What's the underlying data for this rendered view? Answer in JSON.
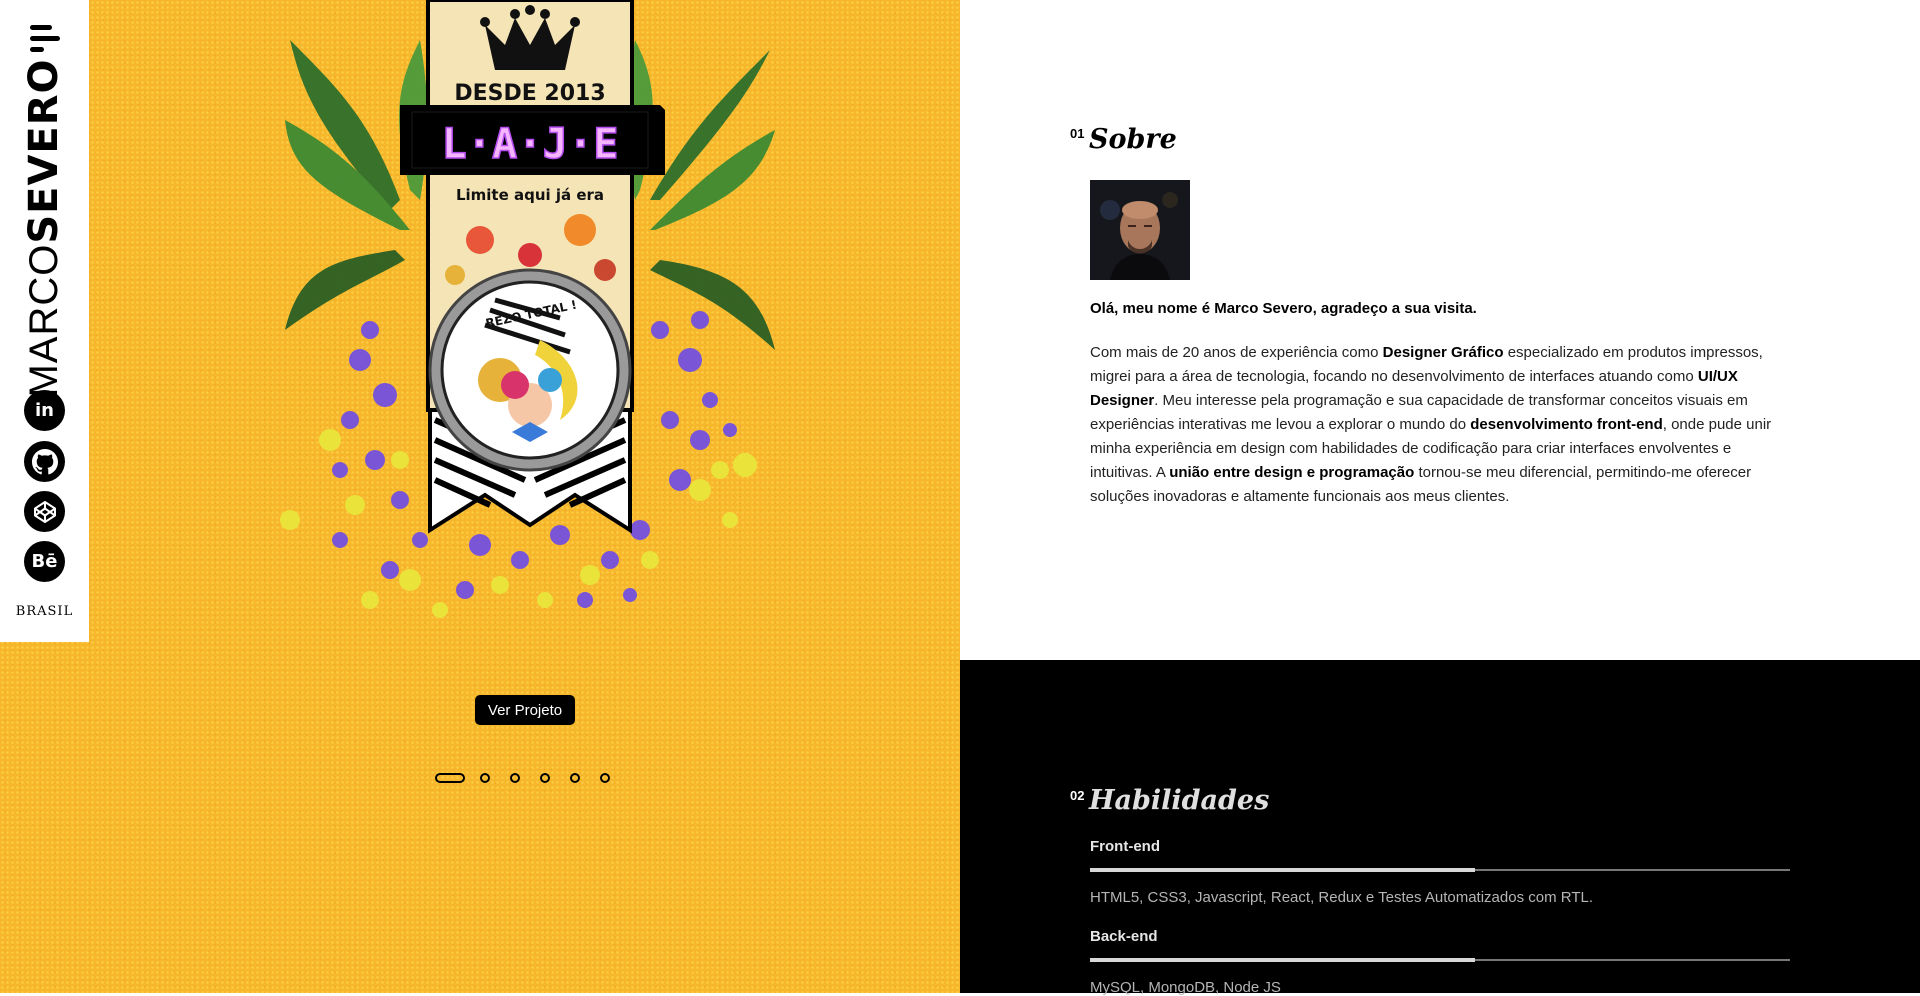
{
  "brand": {
    "first": "MARCO",
    "last": "SEVERO",
    "country": "BRASIL"
  },
  "social": [
    {
      "name": "linkedin",
      "label": "in"
    },
    {
      "name": "github",
      "label": ""
    },
    {
      "name": "codepen",
      "label": ""
    },
    {
      "name": "behance",
      "label": "Bē"
    }
  ],
  "project": {
    "badge_top": "DESDE 2013",
    "badge_sign": "L·A·J·E",
    "badge_tagline": "Limite aqui já era",
    "badge_circle": "REZO TOTAL !",
    "button_label": "Ver Projeto",
    "slides_total": 6,
    "slide_active": 1
  },
  "about": {
    "number": "01",
    "title": "Sobre",
    "greeting": "Olá, meu nome é Marco Severo, agradeço a sua visita.",
    "bio_parts": [
      {
        "t": "Com mais de 20 anos de experiência como ",
        "b": false
      },
      {
        "t": "Designer Gráfico",
        "b": true
      },
      {
        "t": " especializado em produtos impressos, migrei para a área de tecnologia, focando no desenvolvimento de interfaces atuando como ",
        "b": false
      },
      {
        "t": "UI/UX Designer",
        "b": true
      },
      {
        "t": ". Meu interesse pela programação e sua capacidade de transformar conceitos visuais em experiências interativas me levou a explorar o mundo do ",
        "b": false
      },
      {
        "t": "desenvolvimento front-end",
        "b": true
      },
      {
        "t": ", onde pude unir minha experiência em design com habilidades de codificação para criar interfaces envolventes e intuitivas. A ",
        "b": false
      },
      {
        "t": "união entre design e programação",
        "b": true
      },
      {
        "t": " tornou-se meu diferencial, permitindo-me oferecer soluções inovadoras e altamente funcionais aos meus clientes.",
        "b": false
      }
    ]
  },
  "skills": {
    "number": "02",
    "title": "Habilidades",
    "items": [
      {
        "name": "Front-end",
        "level": 0.55,
        "description": "HTML5, CSS3, Javascript, React, Redux e Testes Automatizados com RTL."
      },
      {
        "name": "Back-end",
        "level": 0.55,
        "description": "MySQL, MongoDB, Node JS"
      }
    ]
  },
  "colors": {
    "hero_yellow": "#f7b72c",
    "skills_bg": "#000000",
    "accent_purple": "#7a55d6"
  }
}
